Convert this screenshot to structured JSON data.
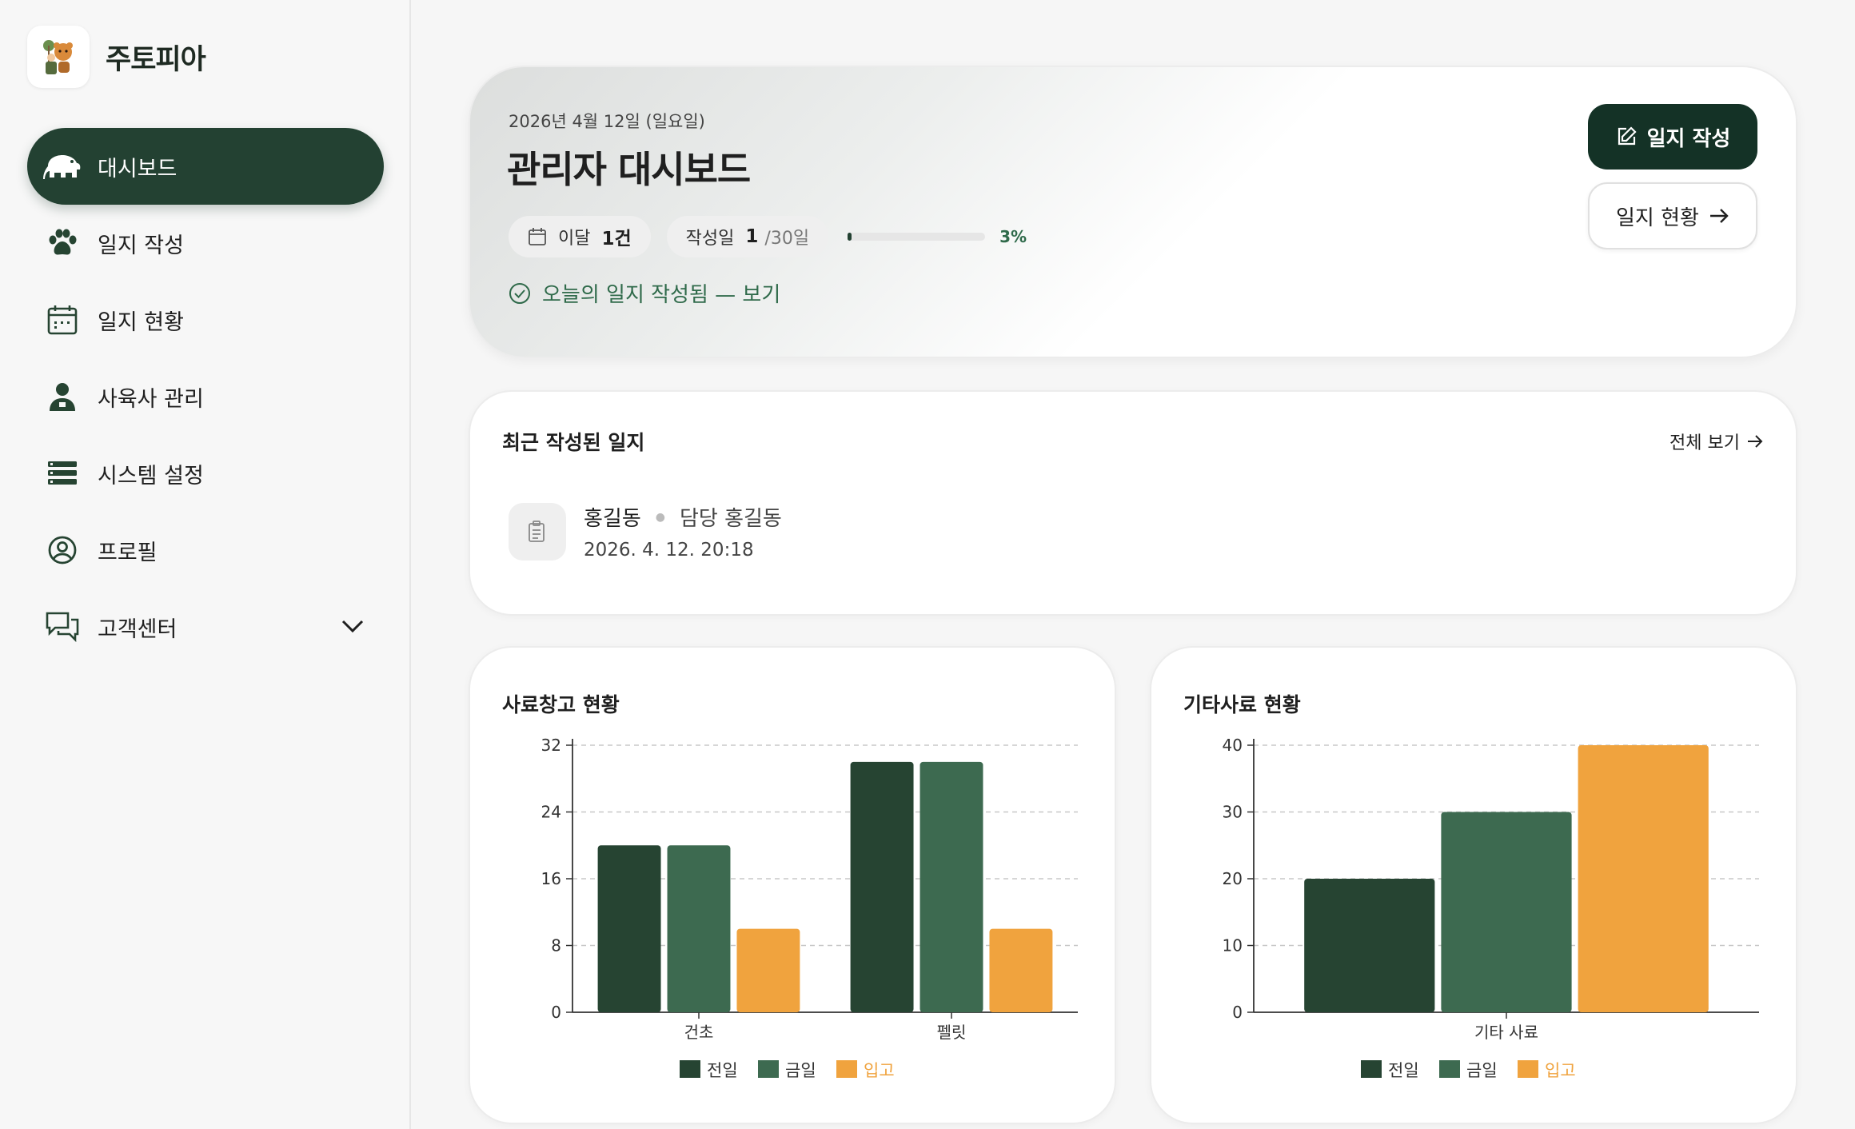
{
  "brand": {
    "name": "주토피아"
  },
  "sidebar": {
    "items": [
      {
        "label": "대시보드",
        "icon": "elephant-icon",
        "active": true
      },
      {
        "label": "일지 작성",
        "icon": "paw-icon"
      },
      {
        "label": "일지 현황",
        "icon": "calendar-icon"
      },
      {
        "label": "사육사 관리",
        "icon": "zookeeper-icon"
      },
      {
        "label": "시스템 설정",
        "icon": "list-settings-icon"
      },
      {
        "label": "프로필",
        "icon": "user-circle-icon"
      },
      {
        "label": "고객센터",
        "icon": "chat-bubbles-icon",
        "expandable": true
      }
    ]
  },
  "hero": {
    "date": "2026년 4월 12일 (일요일)",
    "title": "관리자 대시보드",
    "month_label": "이달",
    "month_count": "1건",
    "written_label": "작성일",
    "written_value": "1",
    "written_total": "/30일",
    "progress_percent": 3,
    "progress_text": "3%",
    "today_link": "오늘의 일지 작성됨 — 보기",
    "write_button": "일지 작성",
    "status_button": "일지 현황"
  },
  "recent": {
    "title": "최근 작성된 일지",
    "view_all": "전체 보기",
    "entry": {
      "name": "홍길동",
      "assignee": "담당 홍길동",
      "datetime": "2026. 4. 12. 20:18"
    }
  },
  "colors": {
    "dark": "#264432",
    "mid": "#3d6a50",
    "orange": "#f0a33e",
    "accent": "#234132"
  },
  "chart_data": [
    {
      "type": "bar",
      "title": "사료창고 현황",
      "categories": [
        "건초",
        "펠릿"
      ],
      "series": [
        {
          "name": "전일",
          "values": [
            20,
            30
          ]
        },
        {
          "name": "금일",
          "values": [
            20,
            30
          ]
        },
        {
          "name": "입고",
          "values": [
            10,
            10
          ]
        }
      ],
      "yticks": [
        0,
        8,
        16,
        24,
        32
      ],
      "ylim": [
        0,
        32
      ],
      "grid": true,
      "legend": "bottom"
    },
    {
      "type": "bar",
      "title": "기타사료 현황",
      "categories": [
        "기타 사료"
      ],
      "series": [
        {
          "name": "전일",
          "values": [
            20
          ]
        },
        {
          "name": "금일",
          "values": [
            30
          ]
        },
        {
          "name": "입고",
          "values": [
            40
          ]
        }
      ],
      "yticks": [
        0,
        10,
        20,
        30,
        40
      ],
      "ylim": [
        0,
        40
      ],
      "grid": true,
      "legend": "bottom"
    }
  ]
}
